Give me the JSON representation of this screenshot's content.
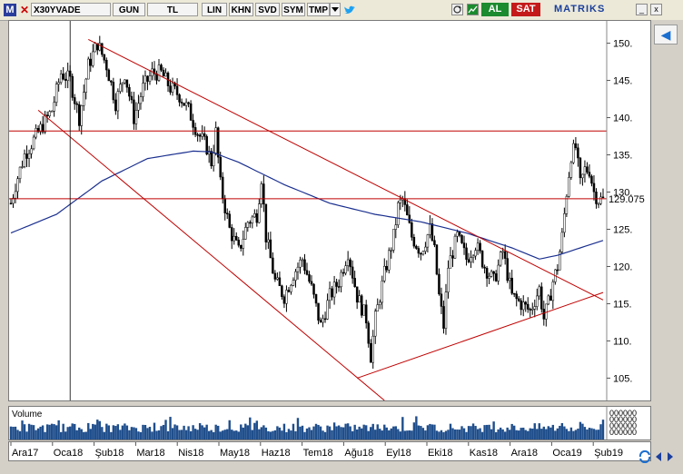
{
  "toolbar": {
    "logo": "M",
    "close": "✕",
    "symbol": "X30YVADE",
    "period": "GUN",
    "currency": "TL",
    "scale_lin": "LIN",
    "khn": "KHN",
    "svd": "SVD",
    "sym": "SYM",
    "tmp": "TMP",
    "buy": "AL",
    "sell": "SAT",
    "brand": "MATRIKS",
    "window_minimize": "_",
    "window_close": "x",
    "icon_dropdown": "dropdown-triangle-icon",
    "icon_twitter": "twitter-icon",
    "icon_refresh": "refresh-icon",
    "icon_chart": "chart-icon"
  },
  "volume_label": "Volume",
  "volume_axis_labels": [
    "000000",
    "000000",
    "000000",
    "000000"
  ],
  "nav_button": "◀",
  "colors": {
    "candle": "#000000",
    "trendline": "#c00000",
    "moving_average": "#1a2f8f",
    "volume_bar": "#1f4e8c"
  },
  "chart_data": {
    "type": "candlestick",
    "title": "",
    "symbol": "X30YVADE",
    "y_ticks": [
      105,
      110,
      115,
      120,
      125,
      130,
      135,
      140,
      145,
      150
    ],
    "ylim": [
      102,
      153
    ],
    "last_price": "129.075",
    "x_tick_labels": [
      "Ara17",
      "Oca18",
      "Şub18",
      "Mar18",
      "Nis18",
      "May18",
      "Haz18",
      "Tem18",
      "Ağu18",
      "Eyl18",
      "Eki18",
      "Kas18",
      "Ara18",
      "Oca19",
      "Şub19"
    ],
    "price_path": [
      [
        0,
        128.5
      ],
      [
        2,
        131
      ],
      [
        6,
        135
      ],
      [
        10,
        137
      ],
      [
        14,
        139
      ],
      [
        18,
        141
      ],
      [
        22,
        146
      ],
      [
        26,
        145
      ],
      [
        30,
        140
      ],
      [
        34,
        147
      ],
      [
        38,
        150
      ],
      [
        42,
        147
      ],
      [
        46,
        142
      ],
      [
        50,
        146
      ],
      [
        54,
        140
      ],
      [
        58,
        144
      ],
      [
        62,
        146
      ],
      [
        66,
        146
      ],
      [
        70,
        144
      ],
      [
        74,
        143
      ],
      [
        78,
        141
      ],
      [
        82,
        138
      ],
      [
        86,
        136
      ],
      [
        88,
        134
      ],
      [
        90,
        138
      ],
      [
        92,
        131
      ],
      [
        96,
        125
      ],
      [
        100,
        122
      ],
      [
        104,
        126
      ],
      [
        108,
        127
      ],
      [
        110,
        132
      ],
      [
        112,
        124
      ],
      [
        116,
        118
      ],
      [
        120,
        116
      ],
      [
        124,
        119
      ],
      [
        128,
        121
      ],
      [
        132,
        117
      ],
      [
        136,
        112
      ],
      [
        140,
        116
      ],
      [
        144,
        118
      ],
      [
        148,
        122
      ],
      [
        152,
        116
      ],
      [
        156,
        113
      ],
      [
        158,
        108
      ],
      [
        160,
        113
      ],
      [
        164,
        119
      ],
      [
        168,
        124
      ],
      [
        170,
        128
      ],
      [
        172,
        129
      ],
      [
        176,
        124
      ],
      [
        180,
        122
      ],
      [
        184,
        125
      ],
      [
        186,
        122
      ],
      [
        188,
        116
      ],
      [
        190,
        112
      ],
      [
        192,
        120
      ],
      [
        196,
        124
      ],
      [
        200,
        121
      ],
      [
        204,
        123
      ],
      [
        208,
        120
      ],
      [
        212,
        118
      ],
      [
        216,
        122
      ],
      [
        220,
        116
      ],
      [
        224,
        115
      ],
      [
        228,
        114
      ],
      [
        232,
        117
      ],
      [
        234,
        113
      ],
      [
        236,
        115
      ],
      [
        238,
        118
      ],
      [
        240,
        120
      ],
      [
        242,
        124
      ],
      [
        244,
        130
      ],
      [
        246,
        135
      ],
      [
        248,
        136
      ],
      [
        250,
        131
      ],
      [
        252,
        133
      ],
      [
        254,
        133
      ],
      [
        256,
        130
      ],
      [
        258,
        129
      ],
      [
        260,
        129
      ]
    ],
    "moving_average": [
      [
        0,
        124.5
      ],
      [
        20,
        127
      ],
      [
        40,
        131.5
      ],
      [
        60,
        134.5
      ],
      [
        80,
        135.5
      ],
      [
        88,
        135.4
      ],
      [
        100,
        134
      ],
      [
        120,
        131
      ],
      [
        140,
        128.5
      ],
      [
        160,
        127
      ],
      [
        180,
        126
      ],
      [
        200,
        124.5
      ],
      [
        220,
        122.5
      ],
      [
        232,
        121
      ],
      [
        240,
        121.5
      ],
      [
        250,
        122.5
      ],
      [
        260,
        123.5
      ]
    ],
    "horizontal_levels": [
      138.2,
      129.1
    ],
    "trendlines": [
      [
        [
          34,
          150.5
        ],
        [
          260,
          115.5
        ]
      ],
      [
        [
          12,
          141
        ],
        [
          164,
          102
        ]
      ],
      [
        [
          152,
          105
        ],
        [
          260,
          116.5
        ]
      ]
    ],
    "cursor_x": 26
  }
}
